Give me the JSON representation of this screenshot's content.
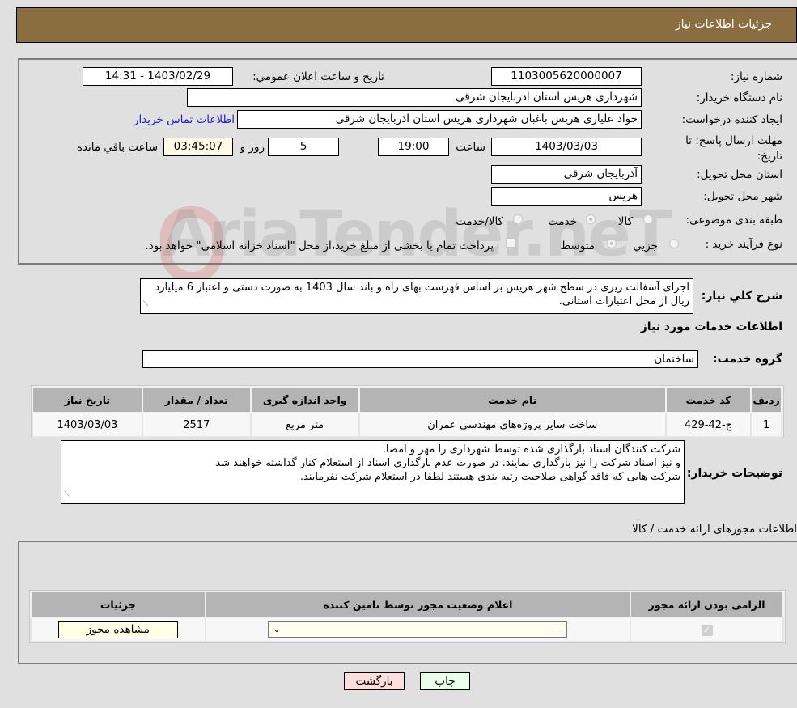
{
  "header": {
    "title": "جزئیات اطلاعات نیاز"
  },
  "fields": {
    "need_number_label": "شماره نیاز:",
    "need_number": "1103005620000007",
    "announce_label": "تاریخ و ساعت اعلان عمومي:",
    "announce_value": "1403/02/29 - 14:31",
    "buyer_org_label": "نام دستگاه خريدار:",
    "buyer_org": "شهرداری هریس استان اذربایجان شرقی",
    "creator_label": "ایجاد کننده درخواست:",
    "creator": "جواد علیاری هریس باغبان شهرداری هریس استان اذربایجان شرقی",
    "contact_link": "اطلاعات تماس خریدار",
    "deadline_label": "مهلت ارسال پاسخ: تا تاریخ:",
    "deadline_date": "1403/03/03",
    "time_label": "ساعت",
    "deadline_time": "19:00",
    "days_value": "5",
    "days_label": "روز و",
    "remaining_time": "03:45:07",
    "remaining_label": "ساعت باقي مانده",
    "province_label": "استان محل تحویل:",
    "province": "آذربایجان شرقی",
    "city_label": "شهر محل تحویل:",
    "city": "هریس",
    "category_label": "طبقه بندی موضوعی:",
    "category_options": [
      "کالا",
      "خدمت",
      "کالا/خدمت"
    ],
    "category_selected": "خدمت",
    "process_label": "نوع فرآيند خريد :",
    "process_options": [
      "جزيي",
      "متوسط"
    ],
    "process_selected": "متوسط",
    "treasury_note": "پرداخت تمام يا بخشی از مبلغ خريد،از محل \"اسناد خزانه اسلامی\" خواهد بود.",
    "description_label": "شرح کلي نياز:",
    "description": "اجرای آسفالت ریزی در سطح شهر هریس بر اساس فهرست بهای راه و باند سال 1403 به صورت دستی و اعتبار 6 میلیارد ریال از محل اعتبارات استانی."
  },
  "services": {
    "section_title": "اطلاعات خدمات مورد نياز",
    "group_label": "گروه خدمت:",
    "group_value": "ساختمان",
    "columns": [
      "رديف",
      "کد خدمت",
      "نام خدمت",
      "واحد اندازه گيری",
      "تعداد / مقدار",
      "تاريخ نياز"
    ],
    "rows": [
      [
        "1",
        "ج-42-429",
        "ساخت سایر پروژه‌های مهندسی عمران",
        "متر مربع",
        "2517",
        "1403/03/03"
      ]
    ]
  },
  "buyer_notes": {
    "label": "توضيحات خريدار:",
    "lines": [
      "شرکت کنندگان اسناد بارگذاری شده توسط شهرداری را مهر و امضا.",
      "و نیز  اسناد شرکت را نیز بارگذاری نمایند. در صورت عدم بارگذاری اسناد از استعلام کنار گذاشته خواهند شد",
      "شرکت هایی که فاقد گواهی صلاحیت رتبه بندی هستند لطفا در استعلام شرکت نفرمایند."
    ]
  },
  "licenses": {
    "section_title": "اطلاعات مجوزهای ارائه خدمت / کالا",
    "columns": [
      "الزامی بودن ارائه مجوز",
      "اعلام وضعیت مجوز توسط تامین کننده",
      "جزئیات"
    ],
    "row": {
      "required_checked": true,
      "status_value": "--",
      "details_button": "مشاهده مجوز"
    }
  },
  "footer": {
    "print_button": "چاپ",
    "back_button": "بازگشت"
  },
  "watermark": {
    "text": "AriaTender.neT"
  }
}
